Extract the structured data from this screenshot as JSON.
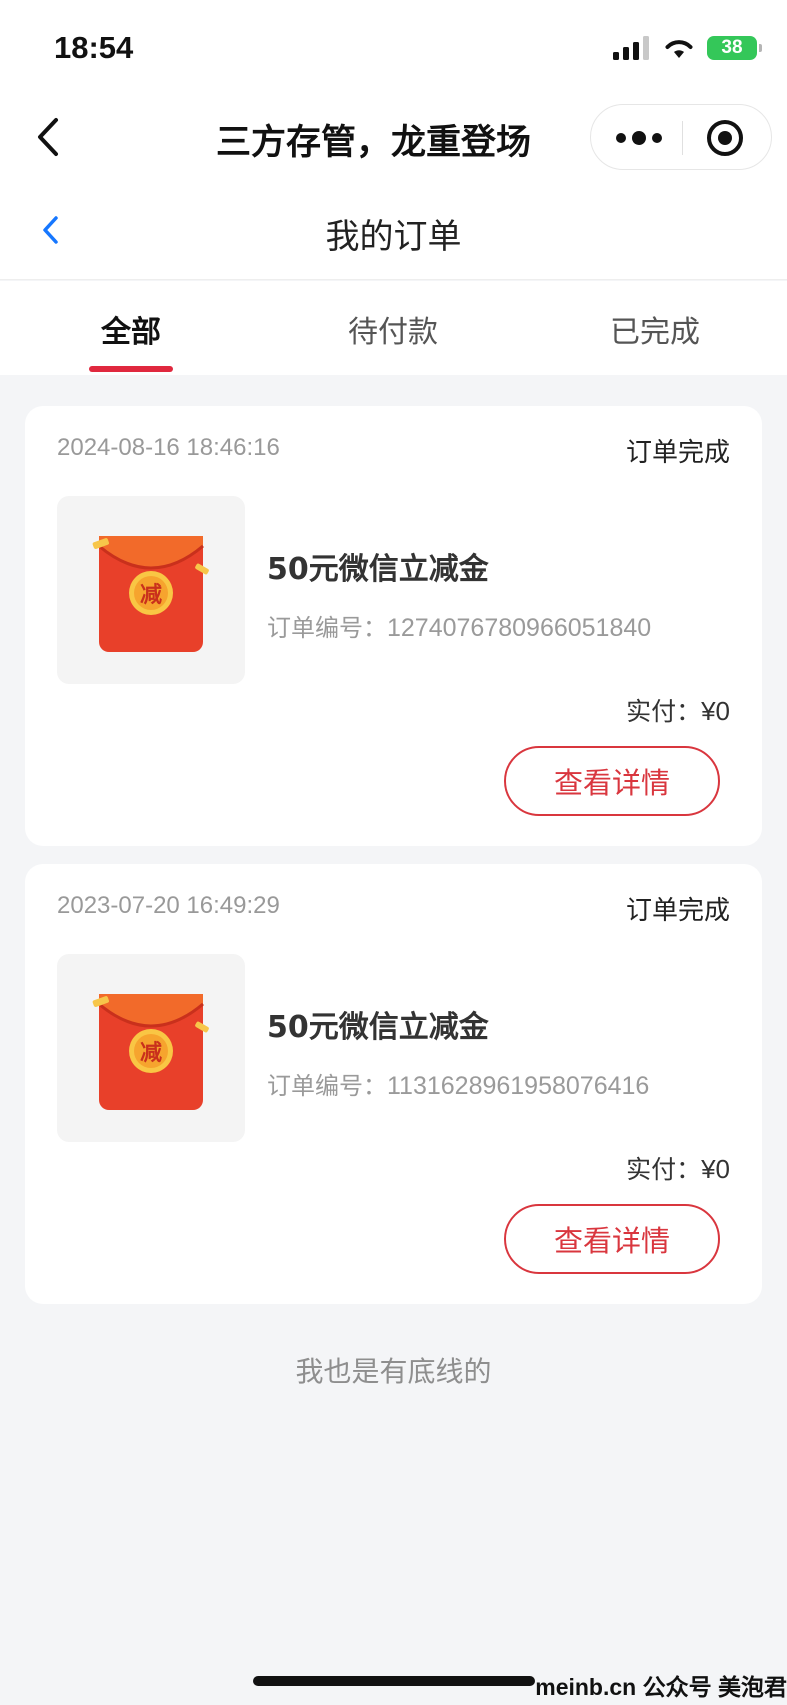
{
  "status_bar": {
    "time": "18:54",
    "battery": "38"
  },
  "mini_program": {
    "title": "三方存管，龙重登场"
  },
  "page": {
    "title": "我的订单"
  },
  "tabs": [
    {
      "label": "全部",
      "active": true
    },
    {
      "label": "待付款",
      "active": false
    },
    {
      "label": "已完成",
      "active": false
    }
  ],
  "orders": [
    {
      "date": "2024-08-16 18:46:16",
      "status": "订单完成",
      "product_name": "50元微信立减金",
      "order_no_label": "订单编号：",
      "order_no": "1274076780966051840",
      "paid_label": "实付：",
      "paid_amount": "¥0",
      "detail_button": "查看详情",
      "thumb_text": "减"
    },
    {
      "date": "2023-07-20 16:49:29",
      "status": "订单完成",
      "product_name": "50元微信立减金",
      "order_no_label": "订单编号：",
      "order_no": "1131628961958076416",
      "paid_label": "实付：",
      "paid_amount": "¥0",
      "detail_button": "查看详情",
      "thumb_text": "减"
    }
  ],
  "footer_note": "我也是有底线的",
  "watermark": "meinb.cn  公众号 美泡君",
  "colors": {
    "accent": "#e0283e",
    "button_red": "#d9363e",
    "back_blue": "#1677ff"
  }
}
